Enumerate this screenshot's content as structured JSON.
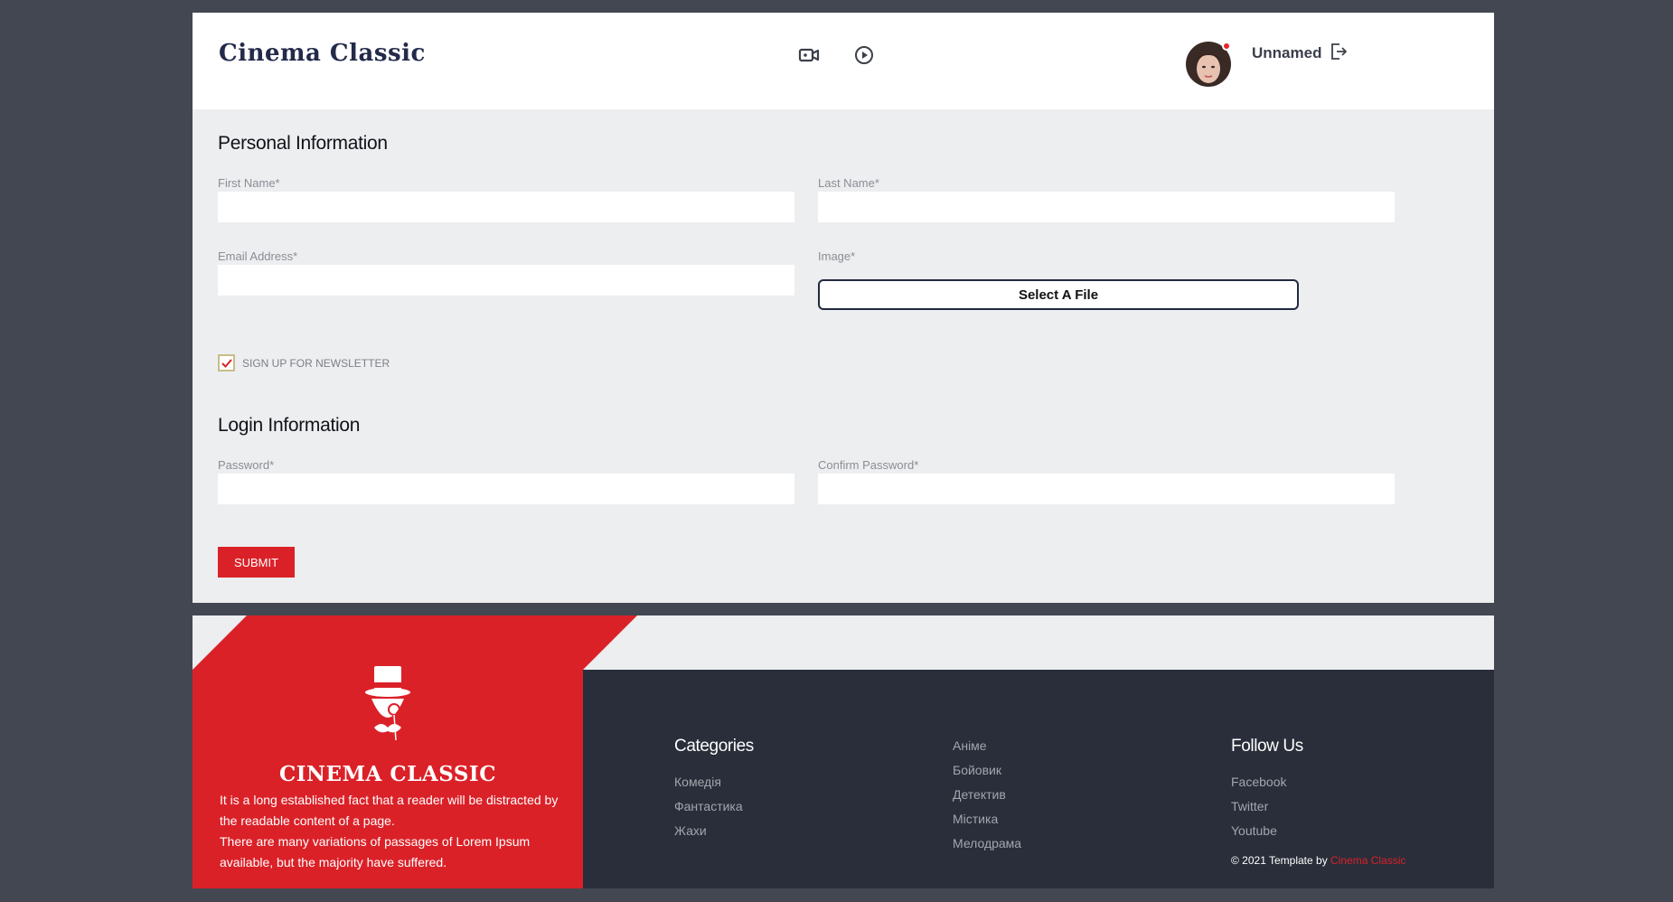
{
  "header": {
    "logo": "Cinema Classic",
    "username": "Unnamed"
  },
  "form": {
    "personal_title": "Personal Information",
    "first_name_label": "First Name*",
    "last_name_label": "Last Name*",
    "email_label": "Email Address*",
    "image_label": "Image*",
    "select_file_label": "Select A File",
    "newsletter_label": "SIGN UP FOR NEWSLETTER",
    "newsletter_checked": true,
    "login_title": "Login Information",
    "password_label": "Password*",
    "confirm_password_label": "Confirm Password*",
    "submit_label": "SUBMIT"
  },
  "footer": {
    "brand_name": "CINEMA CLASSIC",
    "brand_text_1": "It is a long established fact that a reader will be distracted by the readable content of a page.",
    "brand_text_2": "There are many variations of passages of Lorem Ipsum available, but the majority have suffered.",
    "categories_title": "Categories",
    "categories": [
      "Комедія",
      "Фантастика",
      "Жахи"
    ],
    "categories_2": [
      "Аніме",
      "Бойовик",
      "Детектив",
      "Містика",
      "Мелодрама"
    ],
    "follow_title": "Follow Us",
    "follow": [
      "Facebook",
      "Twitter",
      "Youtube"
    ],
    "copyright_prefix": "© 2021 Template by",
    "copyright_brand": "Cinema Classic"
  },
  "colors": {
    "accent": "#db2128",
    "dark": "#292e3a",
    "page_bg": "#434751",
    "form_bg": "#edeef0"
  },
  "icons": [
    "video-camera-icon",
    "play-circle-icon",
    "logout-icon",
    "checkmark-icon",
    "mascot-top-hat-icon"
  ]
}
